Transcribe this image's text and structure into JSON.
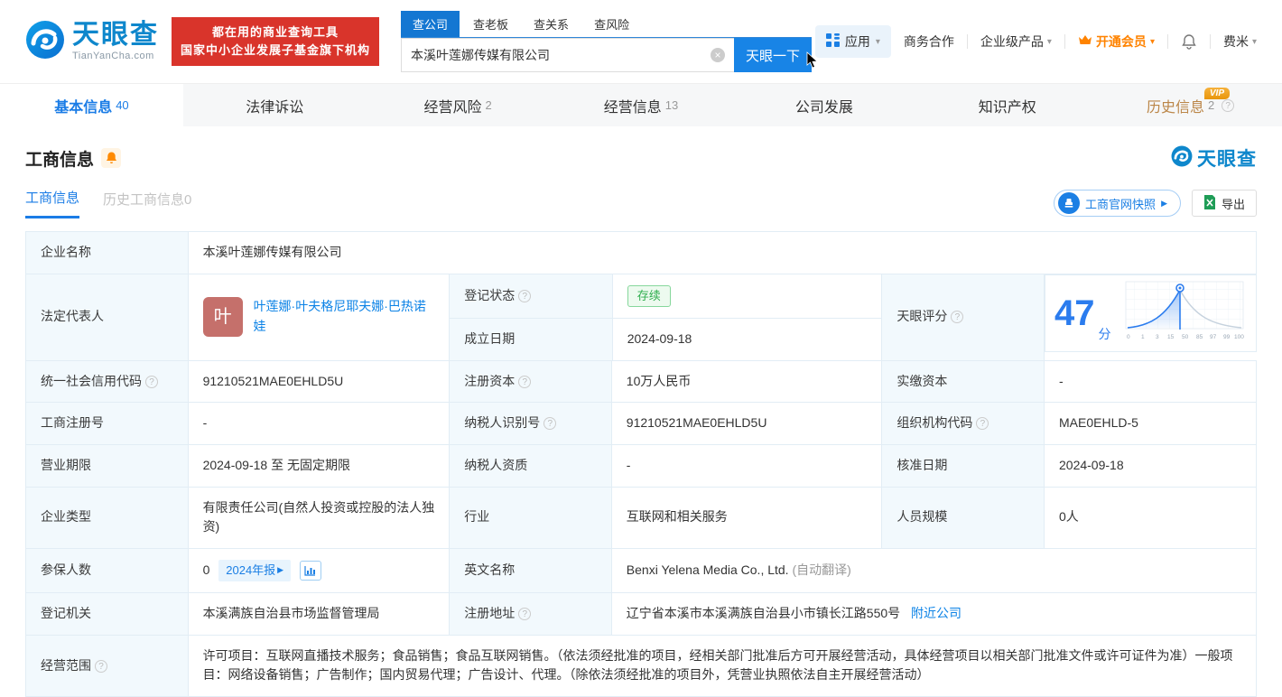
{
  "icons": {
    "caret": "▾",
    "clear": "×",
    "question": "?",
    "arrow_right": "▶",
    "arrow_small": "▶"
  },
  "header": {
    "logo": {
      "brand": "天眼查",
      "domain": "TianYanCha.com"
    },
    "slogan": {
      "line1": "都在用的商业查询工具",
      "line2": "国家中小企业发展子基金旗下机构"
    },
    "search": {
      "tabs": [
        {
          "label": "查公司"
        },
        {
          "label": "查老板"
        },
        {
          "label": "查关系"
        },
        {
          "label": "查风险"
        }
      ],
      "value": "本溪叶莲娜传媒有限公司",
      "button": "天眼一下"
    },
    "nav": {
      "apps": "应用",
      "cooperation": "商务合作",
      "enterprise": "企业级产品",
      "vip": "开通会员",
      "user": "费米"
    }
  },
  "tabs": [
    {
      "label": "基本信息",
      "count": "40"
    },
    {
      "label": "法律诉讼",
      "count": ""
    },
    {
      "label": "经营风险",
      "count": "2"
    },
    {
      "label": "经营信息",
      "count": "13"
    },
    {
      "label": "公司发展",
      "count": ""
    },
    {
      "label": "知识产权",
      "count": ""
    },
    {
      "label": "历史信息",
      "count": "2",
      "vip_badge": "VIP"
    }
  ],
  "section": {
    "title": "工商信息",
    "watermark": "天眼查",
    "subtabs": [
      {
        "label": "工商信息"
      },
      {
        "label": "历史工商信息0"
      }
    ],
    "snapshot_button": "工商官网快照",
    "export_button": "导出"
  },
  "fields": {
    "company_name": {
      "label": "企业名称",
      "value": "本溪叶莲娜传媒有限公司"
    },
    "legal_rep": {
      "label": "法定代表人",
      "avatar": "叶",
      "name": "叶莲娜·叶夫格尼耶夫娜·巴热诺娃"
    },
    "reg_status": {
      "label": "登记状态",
      "value": "存续"
    },
    "establish_date": {
      "label": "成立日期",
      "value": "2024-09-18"
    },
    "tyc_score": {
      "label": "天眼评分",
      "value": "47",
      "unit": "分"
    },
    "credit_code": {
      "label": "统一社会信用代码",
      "value": "91210521MAE0EHLD5U"
    },
    "reg_capital": {
      "label": "注册资本",
      "value": "10万人民币"
    },
    "paid_capital": {
      "label": "实缴资本",
      "value": "-"
    },
    "reg_number": {
      "label": "工商注册号",
      "value": "-"
    },
    "taxpayer_id": {
      "label": "纳税人识别号",
      "value": "91210521MAE0EHLD5U"
    },
    "org_code": {
      "label": "组织机构代码",
      "value": "MAE0EHLD-5"
    },
    "business_term": {
      "label": "营业期限",
      "value": "2024-09-18 至 无固定期限"
    },
    "taxpayer_quality": {
      "label": "纳税人资质",
      "value": "-"
    },
    "approval_date": {
      "label": "核准日期",
      "value": "2024-09-18"
    },
    "company_type": {
      "label": "企业类型",
      "value": "有限责任公司(自然人投资或控股的法人独资)"
    },
    "industry": {
      "label": "行业",
      "value": "互联网和相关服务"
    },
    "staff_size": {
      "label": "人员规模",
      "value": "0人"
    },
    "insured_count": {
      "label": "参保人数",
      "value": "0",
      "report_badge": "2024年报"
    },
    "english_name": {
      "label": "英文名称",
      "value": "Benxi Yelena Media Co., Ltd.",
      "note": "(自动翻译)"
    },
    "reg_authority": {
      "label": "登记机关",
      "value": "本溪满族自治县市场监督管理局"
    },
    "reg_address": {
      "label": "注册地址",
      "value": "辽宁省本溪市本溪满族自治县小市镇长江路550号",
      "link": "附近公司"
    },
    "business_scope": {
      "label": "经营范围",
      "value": "许可项目：互联网直播技术服务；食品销售；食品互联网销售。（依法须经批准的项目，经相关部门批准后方可开展经营活动，具体经营项目以相关部门批准文件或许可证件为准）一般项目：网络设备销售；广告制作；国内贸易代理；广告设计、代理。（除依法须经批准的项目外，凭营业执照依法自主开展经营活动）"
    }
  },
  "chart_data": {
    "type": "area",
    "title": "天眼评分分布曲线",
    "score": 47,
    "x_ticks": [
      "0",
      "1",
      "3",
      "15",
      "50",
      "85",
      "97",
      "99",
      "100"
    ],
    "marker_at_tick": "50",
    "accent_color": "#2b7cee",
    "inactive_color": "#c6d2de"
  },
  "colors": {
    "primary_blue": "#1884e6",
    "link_blue": "#0b82e6",
    "brand_blue": "#0e87cc",
    "red": "#d9342b",
    "orange": "#ff8300",
    "green_status": "#2fae4e",
    "label_bg": "#f2f9fd"
  }
}
